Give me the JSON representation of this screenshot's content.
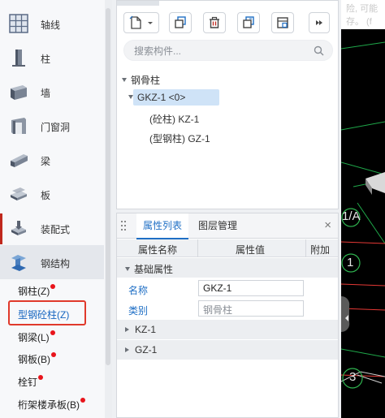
{
  "sidebar": {
    "categories": [
      {
        "label": "轴线",
        "icon": "grid-icon"
      },
      {
        "label": "柱",
        "icon": "column-icon"
      },
      {
        "label": "墙",
        "icon": "wall-icon"
      },
      {
        "label": "门窗洞",
        "icon": "door-window-icon"
      },
      {
        "label": "梁",
        "icon": "beam-icon"
      },
      {
        "label": "板",
        "icon": "slab-icon"
      },
      {
        "label": "装配式",
        "icon": "prefab-icon"
      },
      {
        "label": "钢结构",
        "icon": "steel-structure-icon"
      }
    ],
    "steel_items": [
      {
        "label": "钢柱(Z)",
        "new": true
      },
      {
        "label": "型钢砼柱(Z)",
        "new": false,
        "selected": true
      },
      {
        "label": "钢梁(L)",
        "new": true
      },
      {
        "label": "钢板(B)",
        "new": true
      },
      {
        "label": "栓钉",
        "new": true
      },
      {
        "label": "桁架楼承板(B)",
        "new": true
      }
    ]
  },
  "component_panel": {
    "toolbar": [
      "new-component-icon",
      "dropdown-icon",
      "copy-icon",
      "delete-icon",
      "duplicate-icon",
      "layer-copy-icon",
      "expand-icon"
    ],
    "search_placeholder": "搜索构件...",
    "tree": {
      "root": "钢骨柱",
      "selected_item": "GKZ-1 <0>",
      "children": [
        "(砼柱) KZ-1",
        "(型钢柱) GZ-1"
      ]
    }
  },
  "properties_panel": {
    "tabs": [
      "属性列表",
      "图层管理"
    ],
    "active_tab": "属性列表",
    "close_label": "×",
    "columns": [
      "属性名称",
      "属性值",
      "附加"
    ],
    "group": "基础属性",
    "rows": [
      {
        "name": "名称",
        "value": "GKZ-1",
        "readonly": false
      },
      {
        "name": "类别",
        "value": "钢骨柱",
        "readonly": true
      }
    ],
    "collapsed_groups": [
      "KZ-1",
      "GZ-1"
    ]
  },
  "canvas": {
    "top_text_line1": "险, 可能",
    "top_text_line2": "存。 (f",
    "axis_label_a": "1/A",
    "axis_label_1": "1",
    "axis_label_3": "3",
    "colors": {
      "background": "#000000",
      "axis": "#e53935",
      "grid": "#1fa84a",
      "label_circle": "#2fb34f"
    }
  },
  "colors": {
    "accent": "#1f6fc5",
    "new_dot": "#e8141b",
    "selection_box": "#e0392b",
    "tree_selected_bg": "#cfe3f7"
  }
}
